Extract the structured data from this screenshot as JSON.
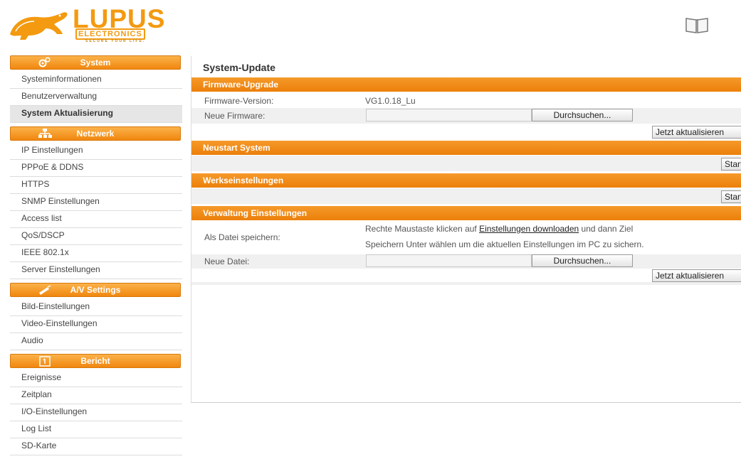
{
  "header": {
    "logo_main": "LUPUS",
    "logo_sub": "ELECTRONICS",
    "logo_tagline": "SECURE YOUR LIFE.",
    "help_icon": "book-icon"
  },
  "sidebar": {
    "sections": [
      {
        "title": "System",
        "icon": "gear-icon",
        "items": [
          {
            "label": "Systeminformationen",
            "active": false
          },
          {
            "label": "Benutzerverwaltung",
            "active": false
          },
          {
            "label": "System Aktualisierung",
            "active": true
          }
        ]
      },
      {
        "title": "Netzwerk",
        "icon": "network-icon",
        "items": [
          {
            "label": "IP Einstellungen",
            "active": false
          },
          {
            "label": "PPPoE & DDNS",
            "active": false
          },
          {
            "label": "HTTPS",
            "active": false
          },
          {
            "label": "SNMP Einstellungen",
            "active": false
          },
          {
            "label": "Access list",
            "active": false
          },
          {
            "label": "QoS/DSCP",
            "active": false
          },
          {
            "label": "IEEE 802.1x",
            "active": false
          },
          {
            "label": "Server Einstellungen",
            "active": false
          }
        ]
      },
      {
        "title": "A/V Settings",
        "icon": "camera-icon",
        "items": [
          {
            "label": "Bild-Einstellungen",
            "active": false
          },
          {
            "label": "Video-Einstellungen",
            "active": false
          },
          {
            "label": "Audio",
            "active": false
          }
        ]
      },
      {
        "title": "Bericht",
        "icon": "calendar-icon",
        "items": [
          {
            "label": "Ereignisse",
            "active": false
          },
          {
            "label": "Zeitplan",
            "active": false
          },
          {
            "label": "I/O-Einstellungen",
            "active": false
          },
          {
            "label": "Log List",
            "active": false
          },
          {
            "label": "SD-Karte",
            "active": false
          }
        ]
      }
    ]
  },
  "main": {
    "title": "System-Update",
    "firmware": {
      "header": "Firmware-Upgrade",
      "version_label": "Firmware-Version:",
      "version_value": "VG1.0.18_Lu",
      "new_label": "Neue Firmware:",
      "browse_label": "Durchsuchen...",
      "update_label": "Jetzt aktualisieren"
    },
    "restart": {
      "header": "Neustart System",
      "start_label": "Start"
    },
    "factory": {
      "header": "Werkseinstellungen",
      "start_label": "Start"
    },
    "config": {
      "header": "Verwaltung Einstellungen",
      "save_label": "Als Datei speichern:",
      "desc_before": "Rechte Maustaste klicken auf ",
      "desc_link": "Einstellungen downloaden",
      "desc_after": " und dann Ziel",
      "desc_line2": "Speichern Unter wählen um die aktuellen Einstellungen im PC zu sichern.",
      "new_file_label": "Neue Datei:",
      "browse_label": "Durchsuchen...",
      "update_label": "Jetzt aktualisieren"
    }
  }
}
